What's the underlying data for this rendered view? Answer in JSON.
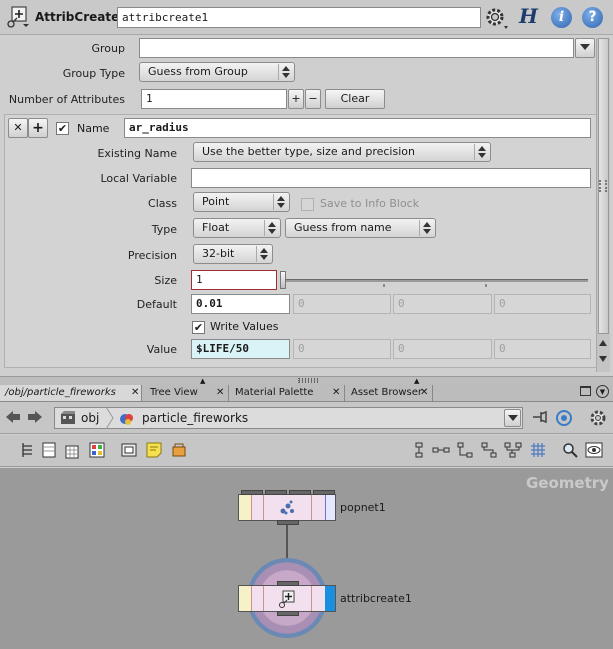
{
  "header": {
    "node_type": "AttribCreate",
    "node_name": "attribcreate1",
    "h_label": "H",
    "info_label": "i",
    "help_label": "?"
  },
  "params": {
    "group_label": "Group",
    "group_value": "",
    "group_type_label": "Group Type",
    "group_type_value": "Guess from Group",
    "num_attrs_label": "Number of Attributes",
    "num_attrs_value": "1",
    "plus_label": "+",
    "minus_label": "−",
    "clear_label": "Clear",
    "remove_label": "✕",
    "add_label": "+",
    "name_label": "Name",
    "name_value": "ar_radius",
    "existing_name_label": "Existing Name",
    "existing_name_value": "Use the better type, size and precision",
    "local_var_label": "Local Variable",
    "local_var_value": "",
    "class_label": "Class",
    "class_value": "Point",
    "save_info_label": "Save to Info Block",
    "type_label": "Type",
    "type_value": "Float",
    "guess_name_value": "Guess from name",
    "precision_label": "Precision",
    "precision_value": "32-bit",
    "size_label": "Size",
    "size_value": "1",
    "default_label": "Default",
    "default_values": [
      "0.01",
      "0",
      "0",
      "0"
    ],
    "write_values_label": "Write Values",
    "value_label": "Value",
    "value_values": [
      "$LIFE/50",
      "0",
      "0",
      "0"
    ]
  },
  "tabs": [
    {
      "label": "/obj/particle_fireworks"
    },
    {
      "label": "Tree View"
    },
    {
      "label": "Material Palette"
    },
    {
      "label": "Asset Browser"
    }
  ],
  "path": {
    "obj": "obj",
    "network": "particle_fireworks"
  },
  "network": {
    "context_label": "Geometry",
    "node1_name": "popnet1",
    "node2_name": "attribcreate1"
  },
  "colors": {
    "panel_bg": "#cfcfcf",
    "network_bg": "#9a9a9a",
    "value_field_bg": "#d9f3f7",
    "size_field_border": "#a03030",
    "selected_ring": "#6a89b5",
    "node_flag_blue": "#1a8fe0"
  },
  "icons": {
    "node": "attribcreate-icon",
    "gear": "gear-icon",
    "help": "help-icon",
    "info": "info-icon",
    "back": "back-arrow-icon",
    "forward": "forward-arrow-icon"
  }
}
